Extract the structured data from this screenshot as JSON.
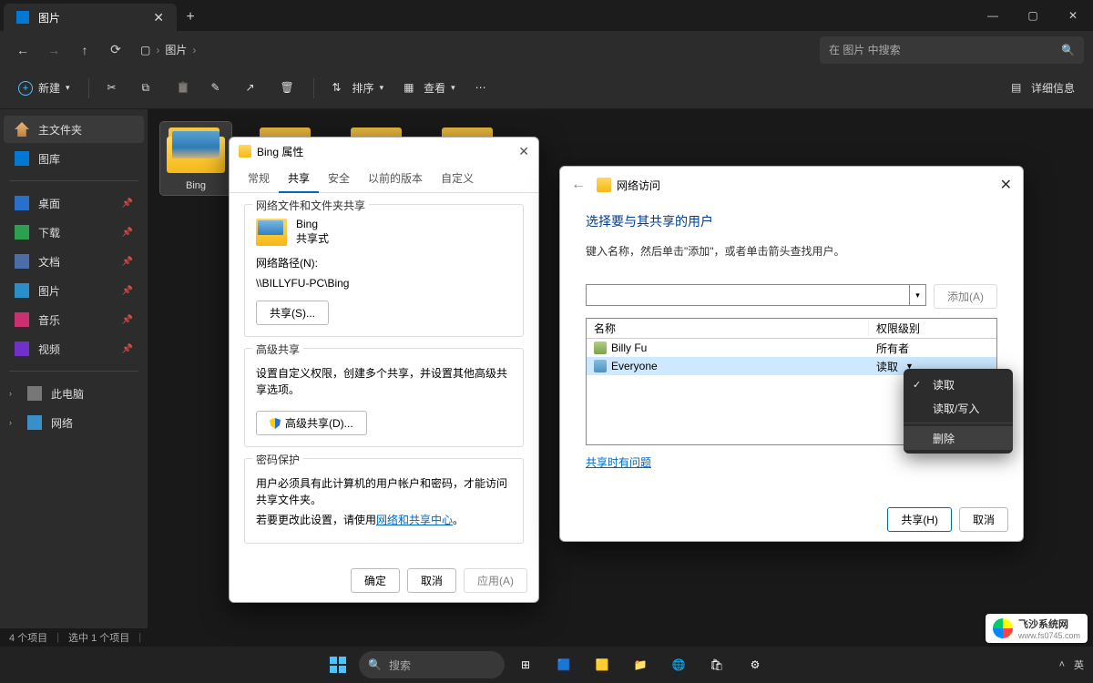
{
  "window": {
    "tab": "图片",
    "min": "—",
    "max": "▢",
    "close": "✕"
  },
  "nav": {
    "path_seg": "图片",
    "search_placeholder": "在 图片 中搜索"
  },
  "toolbar": {
    "new": "新建",
    "sort": "排序",
    "view": "查看",
    "details": "详细信息"
  },
  "sidebar": {
    "home": "主文件夹",
    "gallery": "图库",
    "desktop": "桌面",
    "downloads": "下载",
    "documents": "文档",
    "pictures": "图片",
    "music": "音乐",
    "videos": "视频",
    "thispc": "此电脑",
    "network": "网络"
  },
  "folders": {
    "item0": "Bing"
  },
  "status": {
    "count": "4 个项目",
    "selected": "选中 1 个项目"
  },
  "props_dialog": {
    "title": "Bing 属性",
    "tabs": {
      "general": "常规",
      "sharing": "共享",
      "security": "安全",
      "prev": "以前的版本",
      "custom": "自定义"
    },
    "group1_title": "网络文件和文件夹共享",
    "item_name": "Bing",
    "item_state": "共享式",
    "netpath_label": "网络路径(N):",
    "netpath": "\\\\BILLYFU-PC\\Bing",
    "share_btn": "共享(S)...",
    "group2_title": "高级共享",
    "group2_text": "设置自定义权限，创建多个共享，并设置其他高级共享选项。",
    "adv_share_btn": "高级共享(D)...",
    "group3_title": "密码保护",
    "group3_text1": "用户必须具有此计算机的用户帐户和密码，才能访问共享文件夹。",
    "group3_text2_a": "若要更改此设置，请使用",
    "group3_link": "网络和共享中心",
    "ok": "确定",
    "cancel": "取消",
    "apply": "应用(A)"
  },
  "share_dialog": {
    "crumb": "网络访问",
    "heading": "选择要与其共享的用户",
    "hint": "键入名称，然后单击\"添加\"，或者单击箭头查找用户。",
    "add_btn": "添加(A)",
    "col_name": "名称",
    "col_level": "权限级别",
    "row1_name": "Billy Fu",
    "row1_level": "所有者",
    "row2_name": "Everyone",
    "row2_level": "读取",
    "help": "共享时有问题",
    "share_btn": "共享(H)",
    "cancel_btn": "取消"
  },
  "ctx": {
    "read": "读取",
    "readwrite": "读取/写入",
    "remove": "删除"
  },
  "taskbar": {
    "search": "搜索"
  },
  "tray": {
    "ime": "英",
    "up": "˄"
  },
  "watermark": {
    "brand": "飞沙系统网",
    "url": "www.fs0745.com"
  }
}
